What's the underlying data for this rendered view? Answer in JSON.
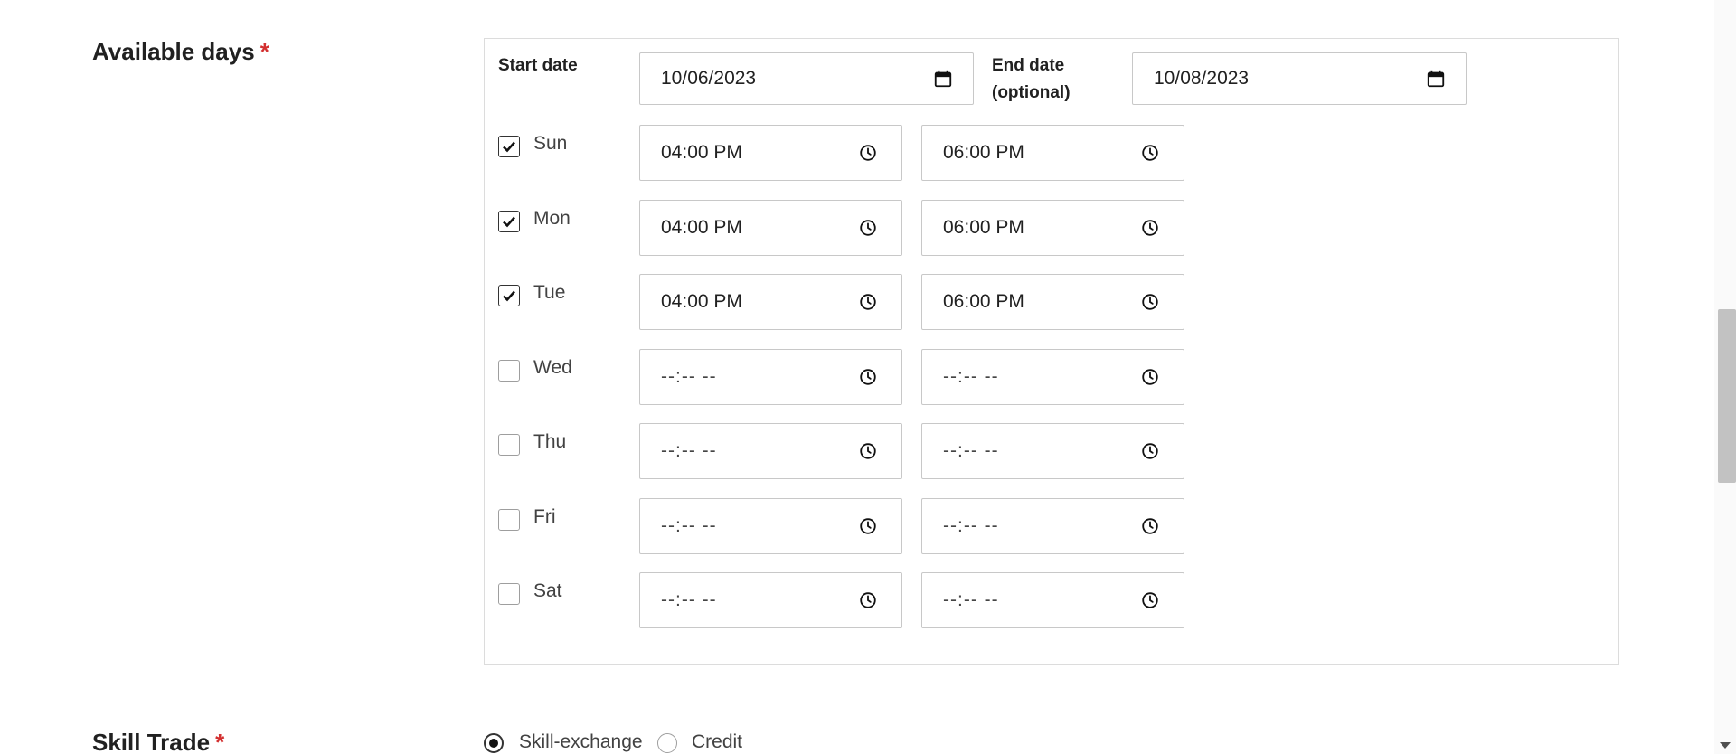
{
  "available_days": {
    "label": "Available days",
    "required_mark": "*",
    "start_date": {
      "label": "Start date",
      "value": "10/06/2023"
    },
    "end_date": {
      "label_line1": "End date",
      "label_line2": "(optional)",
      "value": "10/08/2023"
    },
    "days": [
      {
        "label": "Sun",
        "checked": true,
        "start_time": "04:00 PM",
        "end_time": "06:00 PM"
      },
      {
        "label": "Mon",
        "checked": true,
        "start_time": "04:00 PM",
        "end_time": "06:00 PM"
      },
      {
        "label": "Tue",
        "checked": true,
        "start_time": "04:00 PM",
        "end_time": "06:00 PM"
      },
      {
        "label": "Wed",
        "checked": false,
        "start_time": "--:-- --",
        "end_time": "--:-- --"
      },
      {
        "label": "Thu",
        "checked": false,
        "start_time": "--:-- --",
        "end_time": "--:-- --"
      },
      {
        "label": "Fri",
        "checked": false,
        "start_time": "--:-- --",
        "end_time": "--:-- --"
      },
      {
        "label": "Sat",
        "checked": false,
        "start_time": "--:-- --",
        "end_time": "--:-- --"
      }
    ]
  },
  "skill_trade": {
    "label": "Skill Trade",
    "required_mark": "*",
    "options": [
      {
        "label": "Skill-exchange",
        "selected": true
      },
      {
        "label": "Credit",
        "selected": false
      }
    ]
  },
  "icons": {
    "date": "calendar-icon",
    "time": "clock-icon",
    "check": "checkmark-icon"
  },
  "colors": {
    "required": "#d32f2f",
    "text": "#212121",
    "border": "#c8c8c8"
  }
}
